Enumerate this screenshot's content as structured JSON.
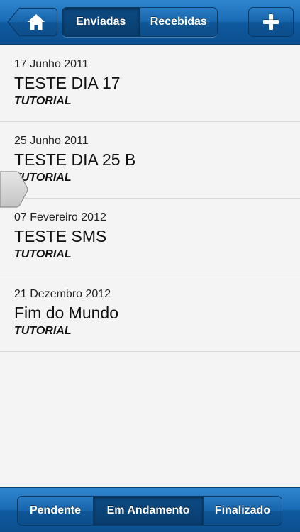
{
  "header": {
    "tabs": [
      {
        "label": "Enviadas",
        "active": true
      },
      {
        "label": "Recebidas",
        "active": false
      }
    ],
    "home_icon": "home-icon",
    "add_icon": "plus-icon"
  },
  "items": [
    {
      "date": "17 Junho 2011",
      "title": "TESTE DIA 17",
      "tag": "TUTORIAL"
    },
    {
      "date": "25 Junho 2011",
      "title": "TESTE DIA 25 B",
      "tag": "TUTORIAL"
    },
    {
      "date": "07 Fevereiro 2012",
      "title": "TESTE SMS",
      "tag": "TUTORIAL"
    },
    {
      "date": "21 Dezembro 2012",
      "title": "Fim do Mundo",
      "tag": "TUTORIAL"
    }
  ],
  "footer": {
    "tabs": [
      {
        "label": "Pendente",
        "active": false
      },
      {
        "label": "Em Andamento",
        "active": true
      },
      {
        "label": "Finalizado",
        "active": false
      }
    ]
  },
  "colors": {
    "bar_blue": "#1a6bb5",
    "active_segment": "#0b4478",
    "background": "#f4f4f4"
  }
}
